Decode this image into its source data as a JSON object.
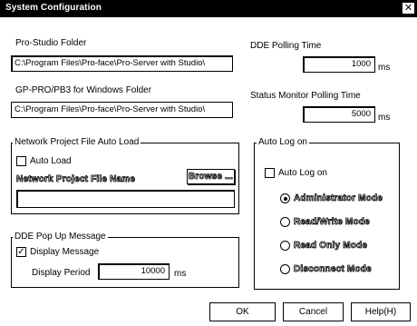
{
  "window": {
    "title": "System Configuration",
    "close_glyph": "✕"
  },
  "pro_studio": {
    "label": "Pro-Studio Folder",
    "value": "C:\\Program Files\\Pro-face\\Pro-Server with Studio\\"
  },
  "gp_pro": {
    "label": "GP-PRO/PB3 for Windows Folder",
    "value": "C:\\Program Files\\Pro-face\\Pro-Server with Studio\\"
  },
  "dde_polling": {
    "label": "DDE Polling Time",
    "value": "1000",
    "unit": "ms"
  },
  "status_monitor": {
    "label": "Status Monitor Polling Time",
    "value": "5000",
    "unit": "ms"
  },
  "network_project": {
    "group_title": "Network Project File Auto Load",
    "auto_load_label": "Auto Load",
    "auto_load_checked": false,
    "file_name_label": "Network Project File Name",
    "browse_label": "Browse ...",
    "file_name_value": ""
  },
  "dde_popup": {
    "group_title": "DDE Pop Up Message",
    "display_message_label": "Display Message",
    "display_message_checked": true,
    "display_period_label": "Display Period",
    "display_period_value": "10000",
    "display_period_unit": "ms"
  },
  "auto_log_on": {
    "group_title": "Auto Log on",
    "checkbox_label": "Auto Log on",
    "checked": false,
    "modes": [
      {
        "label": "Administrator Mode",
        "selected": true
      },
      {
        "label": "Read/Write Mode",
        "selected": false
      },
      {
        "label": "Read Only Mode",
        "selected": false
      },
      {
        "label": "Disconnect Mode",
        "selected": false
      }
    ]
  },
  "buttons": {
    "ok": "OK",
    "cancel": "Cancel",
    "help": "Help(H)"
  }
}
